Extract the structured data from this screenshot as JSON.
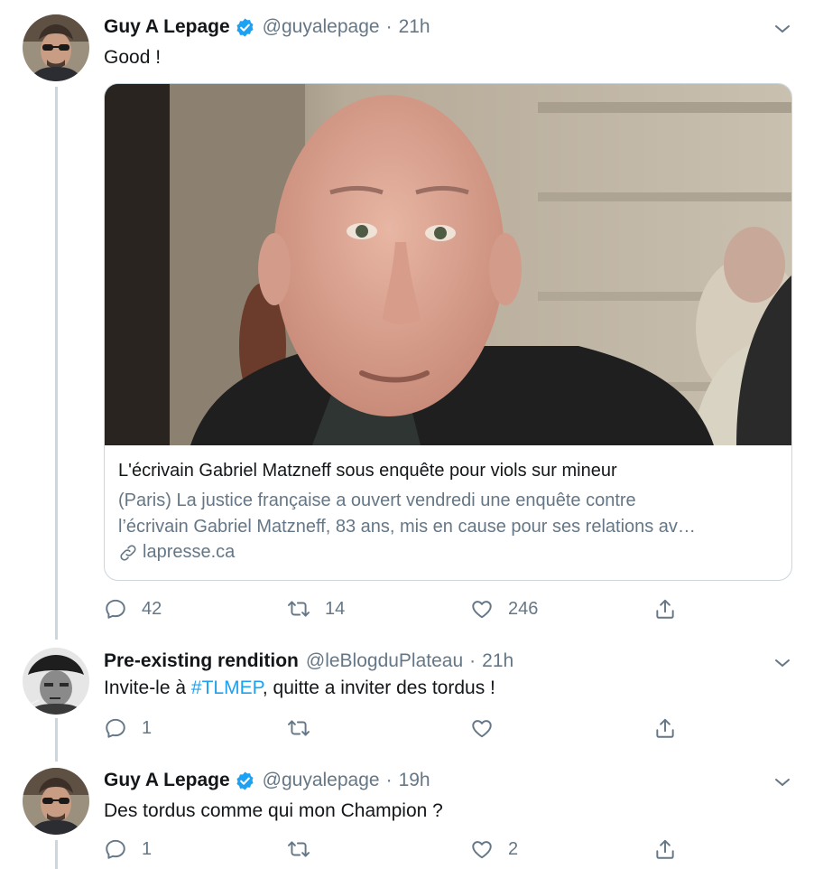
{
  "tweets": [
    {
      "name": "Guy A Lepage",
      "verified": true,
      "handle": "@guyalepage",
      "separator": "·",
      "time": "21h",
      "text": "Good !",
      "card": {
        "title": "L'écrivain Gabriel Matzneff sous enquête pour viols sur mineur",
        "description_line1": "(Paris) La justice française a ouvert vendredi une enquête contre",
        "description_line2": "l’écrivain Gabriel Matzneff, 83 ans, mis en cause pour ses relations av…",
        "domain": "lapresse.ca"
      },
      "actions": {
        "replies": "42",
        "retweets": "14",
        "likes": "246"
      }
    },
    {
      "name": "Pre-existing rendition",
      "verified": false,
      "handle": "@leBlogduPlateau",
      "separator": "·",
      "time": "21h",
      "text_before": "Invite-le à ",
      "hashtag": "#TLMEP",
      "text_after": ", quitte a inviter des tordus !",
      "actions": {
        "replies": "1",
        "retweets": "",
        "likes": ""
      }
    },
    {
      "name": "Guy A Lepage",
      "verified": true,
      "handle": "@guyalepage",
      "separator": "·",
      "time": "19h",
      "text": "Des tordus comme qui mon Champion ?",
      "actions": {
        "replies": "1",
        "retweets": "",
        "likes": "2"
      }
    }
  ],
  "colors": {
    "accent": "#1da1f2",
    "muted": "#657786",
    "border": "#ccd6dd",
    "text": "#14171a"
  }
}
